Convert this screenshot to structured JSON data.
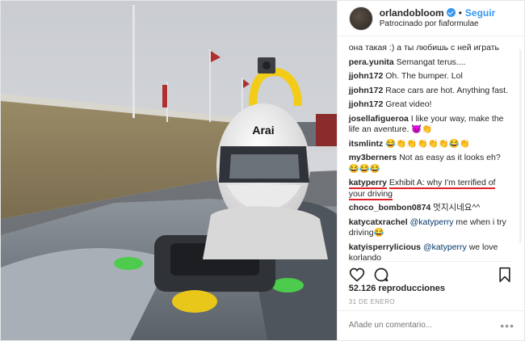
{
  "header": {
    "username": "orlandobloom",
    "separator": "•",
    "follow_label": "Seguir",
    "sponsored": "Patrocinado por fiaformulae"
  },
  "comments": [
    {
      "user": "",
      "text": "она такая :) а ты любишь с ней играть"
    },
    {
      "user": "pera.yunita",
      "text": "Semangat terus...."
    },
    {
      "user": "jjohn172",
      "text": "Oh. The bumper. Lol"
    },
    {
      "user": "jjohn172",
      "text": "Race cars are hot. Anything fast."
    },
    {
      "user": "jjohn172",
      "text": "Great video!"
    },
    {
      "user": "josellafigueroa",
      "text": "I like your way, make the life an aventure. 😈👏"
    },
    {
      "user": "itsmlintz",
      "text": "😂👏👏👏👏👏😂👏"
    },
    {
      "user": "my3berners",
      "text": "Not as easy as it looks eh? 😂😂😂"
    },
    {
      "user": "katyperry",
      "text": "Exhibit A: why I'm terrified of your driving",
      "highlight": true
    },
    {
      "user": "choco_bombon0874",
      "text": "멋지시네요^^"
    },
    {
      "user": "katycatxrachel",
      "mention": "@katyperry",
      "text": "me when i try driving😂"
    },
    {
      "user": "katyisperrylicious",
      "mention": "@katyperry",
      "text": "we love korlando"
    }
  ],
  "views": "52.126 reproducciones",
  "date": "31 DE ENERO",
  "add_comment_placeholder": "Añade un comentario...",
  "more_label": "•••",
  "icons": {
    "like": "heart-icon",
    "comment": "comment-icon",
    "save": "bookmark-icon",
    "verified": "verified-badge-icon"
  },
  "media": {
    "helmet_brand": "Arai"
  }
}
